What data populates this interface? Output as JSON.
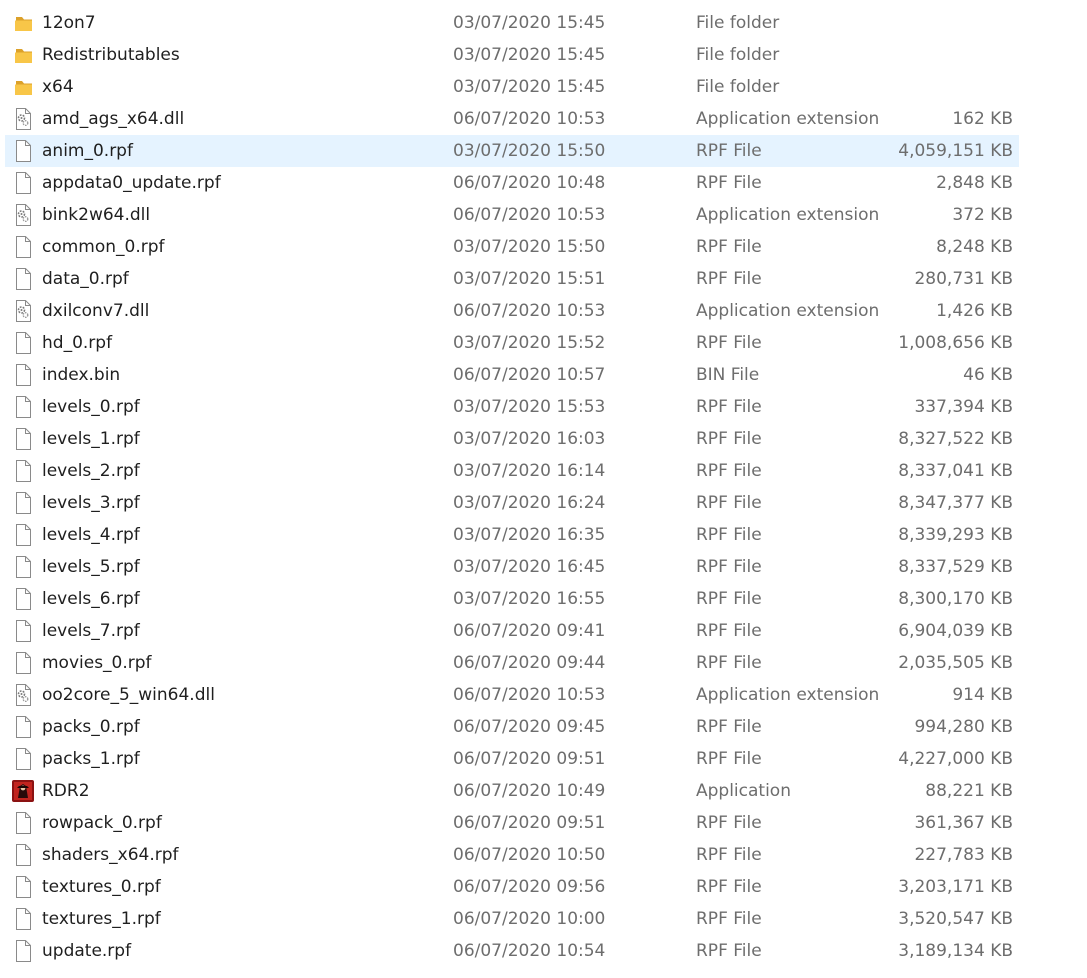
{
  "files": [
    {
      "name": "12on7",
      "date": "03/07/2020 15:45",
      "type": "File folder",
      "size": "",
      "icon": "folder-icon"
    },
    {
      "name": "Redistributables",
      "date": "03/07/2020 15:45",
      "type": "File folder",
      "size": "",
      "icon": "folder-icon"
    },
    {
      "name": "x64",
      "date": "03/07/2020 15:45",
      "type": "File folder",
      "size": "",
      "icon": "folder-icon"
    },
    {
      "name": "amd_ags_x64.dll",
      "date": "06/07/2020 10:53",
      "type": "Application extension",
      "size": "162 KB",
      "icon": "dll-file-icon"
    },
    {
      "name": "anim_0.rpf",
      "date": "03/07/2020 15:50",
      "type": "RPF File",
      "size": "4,059,151 KB",
      "icon": "file-icon",
      "selected": true
    },
    {
      "name": "appdata0_update.rpf",
      "date": "06/07/2020 10:48",
      "type": "RPF File",
      "size": "2,848 KB",
      "icon": "file-icon"
    },
    {
      "name": "bink2w64.dll",
      "date": "06/07/2020 10:53",
      "type": "Application extension",
      "size": "372 KB",
      "icon": "dll-file-icon"
    },
    {
      "name": "common_0.rpf",
      "date": "03/07/2020 15:50",
      "type": "RPF File",
      "size": "8,248 KB",
      "icon": "file-icon"
    },
    {
      "name": "data_0.rpf",
      "date": "03/07/2020 15:51",
      "type": "RPF File",
      "size": "280,731 KB",
      "icon": "file-icon"
    },
    {
      "name": "dxilconv7.dll",
      "date": "06/07/2020 10:53",
      "type": "Application extension",
      "size": "1,426 KB",
      "icon": "dll-file-icon"
    },
    {
      "name": "hd_0.rpf",
      "date": "03/07/2020 15:52",
      "type": "RPF File",
      "size": "1,008,656 KB",
      "icon": "file-icon"
    },
    {
      "name": "index.bin",
      "date": "06/07/2020 10:57",
      "type": "BIN File",
      "size": "46 KB",
      "icon": "file-icon"
    },
    {
      "name": "levels_0.rpf",
      "date": "03/07/2020 15:53",
      "type": "RPF File",
      "size": "337,394 KB",
      "icon": "file-icon"
    },
    {
      "name": "levels_1.rpf",
      "date": "03/07/2020 16:03",
      "type": "RPF File",
      "size": "8,327,522 KB",
      "icon": "file-icon"
    },
    {
      "name": "levels_2.rpf",
      "date": "03/07/2020 16:14",
      "type": "RPF File",
      "size": "8,337,041 KB",
      "icon": "file-icon"
    },
    {
      "name": "levels_3.rpf",
      "date": "03/07/2020 16:24",
      "type": "RPF File",
      "size": "8,347,377 KB",
      "icon": "file-icon"
    },
    {
      "name": "levels_4.rpf",
      "date": "03/07/2020 16:35",
      "type": "RPF File",
      "size": "8,339,293 KB",
      "icon": "file-icon"
    },
    {
      "name": "levels_5.rpf",
      "date": "03/07/2020 16:45",
      "type": "RPF File",
      "size": "8,337,529 KB",
      "icon": "file-icon"
    },
    {
      "name": "levels_6.rpf",
      "date": "03/07/2020 16:55",
      "type": "RPF File",
      "size": "8,300,170 KB",
      "icon": "file-icon"
    },
    {
      "name": "levels_7.rpf",
      "date": "06/07/2020 09:41",
      "type": "RPF File",
      "size": "6,904,039 KB",
      "icon": "file-icon"
    },
    {
      "name": "movies_0.rpf",
      "date": "06/07/2020 09:44",
      "type": "RPF File",
      "size": "2,035,505 KB",
      "icon": "file-icon"
    },
    {
      "name": "oo2core_5_win64.dll",
      "date": "06/07/2020 10:53",
      "type": "Application extension",
      "size": "914 KB",
      "icon": "dll-file-icon"
    },
    {
      "name": "packs_0.rpf",
      "date": "06/07/2020 09:45",
      "type": "RPF File",
      "size": "994,280 KB",
      "icon": "file-icon"
    },
    {
      "name": "packs_1.rpf",
      "date": "06/07/2020 09:51",
      "type": "RPF File",
      "size": "4,227,000 KB",
      "icon": "file-icon"
    },
    {
      "name": "RDR2",
      "date": "06/07/2020 10:49",
      "type": "Application",
      "size": "88,221 KB",
      "icon": "rdr2-app-icon"
    },
    {
      "name": "rowpack_0.rpf",
      "date": "06/07/2020 09:51",
      "type": "RPF File",
      "size": "361,367 KB",
      "icon": "file-icon"
    },
    {
      "name": "shaders_x64.rpf",
      "date": "06/07/2020 10:50",
      "type": "RPF File",
      "size": "227,783 KB",
      "icon": "file-icon"
    },
    {
      "name": "textures_0.rpf",
      "date": "06/07/2020 09:56",
      "type": "RPF File",
      "size": "3,203,171 KB",
      "icon": "file-icon"
    },
    {
      "name": "textures_1.rpf",
      "date": "06/07/2020 10:00",
      "type": "RPF File",
      "size": "3,520,547 KB",
      "icon": "file-icon"
    },
    {
      "name": "update.rpf",
      "date": "06/07/2020 10:54",
      "type": "RPF File",
      "size": "3,189,134 KB",
      "icon": "file-icon"
    }
  ],
  "colors": {
    "selection": "#e5f3ff",
    "folder": "#f8c648",
    "text_primary": "#1f1f1f",
    "text_secondary": "#6d6d6d"
  }
}
